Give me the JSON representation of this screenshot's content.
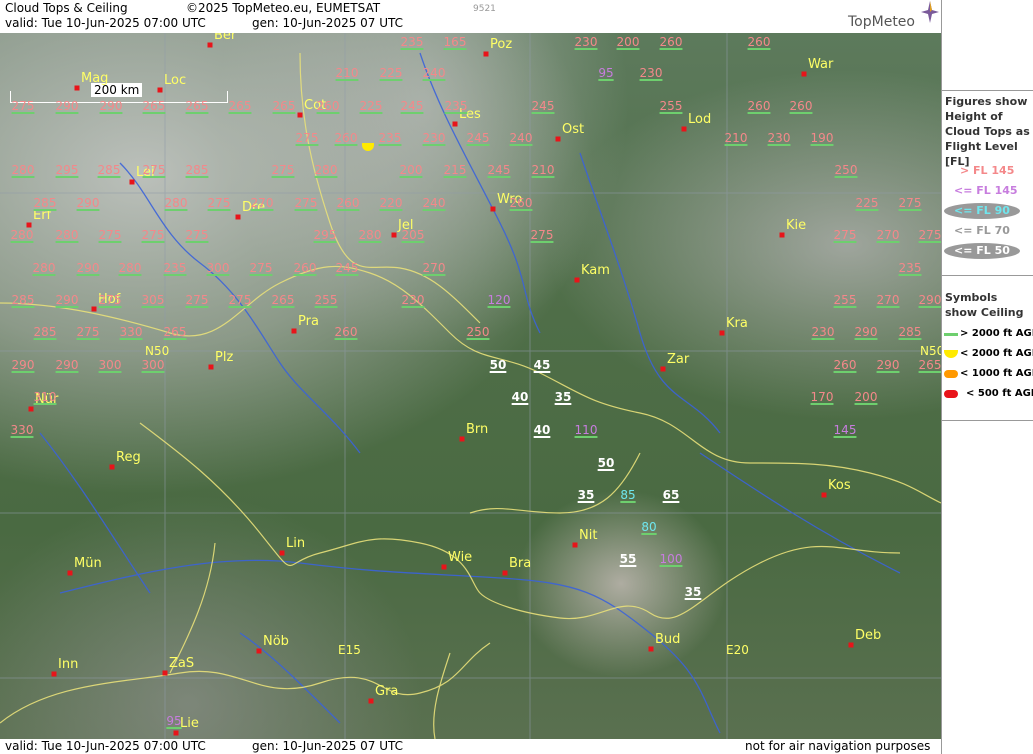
{
  "header": {
    "title": "Cloud Tops & Ceiling",
    "copyright": "©2025 TopMeteo.eu, EUMETSAT",
    "valid": "valid:  Tue  10-Jun-2025  07:00 UTC",
    "gen": "gen: 10-Jun-2025 07 UTC",
    "code": "9521",
    "logo": "TopMeteo"
  },
  "scale_label": "200 km",
  "legend": {
    "fl_title": "Figures show Height of Cloud Tops as Flight Level  [FL]",
    "fl_items": [
      {
        "label": "> FL 145",
        "color": "#f4888a"
      },
      {
        "label": "<= FL 145",
        "color": "#c77dde"
      },
      {
        "label": "<= FL 90",
        "color": "#6fe6ee"
      },
      {
        "label": "<= FL 70",
        "color": "#999999"
      },
      {
        "label": "<= FL 50",
        "color": "#ffffff"
      }
    ],
    "ceiling_title": "Symbols show Ceiling",
    "ceiling_items": [
      {
        "label": "> 2000 ft AGL",
        "color": "#6ecf6e"
      },
      {
        "label": "< 2000 ft AGL",
        "color": "#ffea00"
      },
      {
        "label": "< 1000 ft AGL",
        "color": "#ff9900"
      },
      {
        "label": "< 500 ft AGL",
        "color": "#e8141a"
      }
    ]
  },
  "footer": {
    "valid": "valid:  Tue  10-Jun-2025  07:00 UTC",
    "gen": "gen: 10-Jun-2025 07 UTC",
    "note": "not for air navigation purposes"
  },
  "grid_labels": [
    "N50",
    "N50",
    "E15",
    "E20"
  ],
  "cities": [
    "Ber",
    "Poz",
    "War",
    "Mag",
    "Loc",
    "Cot",
    "Les",
    "Lod",
    "Ost",
    "Lei",
    "Wro",
    "Dre",
    "Erf",
    "Jel",
    "Kie",
    "Kam",
    "Hof",
    "Pra",
    "Kra",
    "Plz",
    "Zar",
    "Nür",
    "Brn",
    "Reg",
    "Kos",
    "Nit",
    "Lin",
    "Mün",
    "Wie",
    "Bra",
    "Bud",
    "Deb",
    "Nöb",
    "Inn",
    "ZaS",
    "Gra",
    "Lie"
  ],
  "cloud_tops": [
    {
      "v": "235",
      "c": "hi"
    },
    {
      "v": "165",
      "c": "hi"
    },
    {
      "v": "230",
      "c": "hi"
    },
    {
      "v": "200",
      "c": "hi"
    },
    {
      "v": "260",
      "c": "hi"
    },
    {
      "v": "260",
      "c": "hi"
    },
    {
      "v": "95",
      "c": "mid"
    },
    {
      "v": "230",
      "c": "hi"
    },
    {
      "v": "210",
      "c": "hi"
    },
    {
      "v": "225",
      "c": "hi"
    },
    {
      "v": "240",
      "c": "hi"
    },
    {
      "v": "275",
      "c": "hi"
    },
    {
      "v": "290",
      "c": "hi"
    },
    {
      "v": "290",
      "c": "hi"
    },
    {
      "v": "265",
      "c": "hi"
    },
    {
      "v": "265",
      "c": "hi"
    },
    {
      "v": "265",
      "c": "hi"
    },
    {
      "v": "265",
      "c": "hi"
    },
    {
      "v": "260",
      "c": "hi"
    },
    {
      "v": "225",
      "c": "hi"
    },
    {
      "v": "245",
      "c": "hi"
    },
    {
      "v": "235",
      "c": "hi"
    },
    {
      "v": "245",
      "c": "hi"
    },
    {
      "v": "255",
      "c": "hi"
    },
    {
      "v": "260",
      "c": "hi"
    },
    {
      "v": "260",
      "c": "hi"
    },
    {
      "v": "275",
      "c": "hi"
    },
    {
      "v": "260",
      "c": "hi"
    },
    {
      "v": "235",
      "c": "hi"
    },
    {
      "v": "230",
      "c": "hi"
    },
    {
      "v": "245",
      "c": "hi"
    },
    {
      "v": "240",
      "c": "hi"
    },
    {
      "v": "210",
      "c": "hi"
    },
    {
      "v": "230",
      "c": "hi"
    },
    {
      "v": "190",
      "c": "hi"
    },
    {
      "v": "280",
      "c": "hi"
    },
    {
      "v": "295",
      "c": "hi"
    },
    {
      "v": "285",
      "c": "hi"
    },
    {
      "v": "275",
      "c": "hi"
    },
    {
      "v": "285",
      "c": "hi"
    },
    {
      "v": "275",
      "c": "hi"
    },
    {
      "v": "280",
      "c": "hi"
    },
    {
      "v": "200",
      "c": "hi"
    },
    {
      "v": "215",
      "c": "hi"
    },
    {
      "v": "245",
      "c": "hi"
    },
    {
      "v": "210",
      "c": "hi"
    },
    {
      "v": "250",
      "c": "hi"
    },
    {
      "v": "285",
      "c": "hi"
    },
    {
      "v": "290",
      "c": "hi"
    },
    {
      "v": "280",
      "c": "hi"
    },
    {
      "v": "275",
      "c": "hi"
    },
    {
      "v": "270",
      "c": "hi"
    },
    {
      "v": "275",
      "c": "hi"
    },
    {
      "v": "260",
      "c": "hi"
    },
    {
      "v": "220",
      "c": "hi"
    },
    {
      "v": "240",
      "c": "hi"
    },
    {
      "v": "260",
      "c": "hi"
    },
    {
      "v": "225",
      "c": "hi"
    },
    {
      "v": "275",
      "c": "hi"
    },
    {
      "v": "280",
      "c": "hi"
    },
    {
      "v": "280",
      "c": "hi"
    },
    {
      "v": "275",
      "c": "hi"
    },
    {
      "v": "275",
      "c": "hi"
    },
    {
      "v": "275",
      "c": "hi"
    },
    {
      "v": "295",
      "c": "hi"
    },
    {
      "v": "280",
      "c": "hi"
    },
    {
      "v": "205",
      "c": "hi"
    },
    {
      "v": "275",
      "c": "hi"
    },
    {
      "v": "275",
      "c": "hi"
    },
    {
      "v": "270",
      "c": "hi"
    },
    {
      "v": "275",
      "c": "hi"
    },
    {
      "v": "280",
      "c": "hi"
    },
    {
      "v": "290",
      "c": "hi"
    },
    {
      "v": "280",
      "c": "hi"
    },
    {
      "v": "235",
      "c": "hi"
    },
    {
      "v": "300",
      "c": "hi"
    },
    {
      "v": "275",
      "c": "hi"
    },
    {
      "v": "260",
      "c": "hi"
    },
    {
      "v": "245",
      "c": "hi"
    },
    {
      "v": "270",
      "c": "hi"
    },
    {
      "v": "235",
      "c": "hi"
    },
    {
      "v": "285",
      "c": "hi"
    },
    {
      "v": "290",
      "c": "hi"
    },
    {
      "v": "275",
      "c": "hi"
    },
    {
      "v": "305",
      "c": "hi"
    },
    {
      "v": "275",
      "c": "hi"
    },
    {
      "v": "275",
      "c": "hi"
    },
    {
      "v": "265",
      "c": "hi"
    },
    {
      "v": "255",
      "c": "hi"
    },
    {
      "v": "230",
      "c": "hi"
    },
    {
      "v": "120",
      "c": "mid"
    },
    {
      "v": "255",
      "c": "hi"
    },
    {
      "v": "270",
      "c": "hi"
    },
    {
      "v": "290",
      "c": "hi"
    },
    {
      "v": "285",
      "c": "hi"
    },
    {
      "v": "275",
      "c": "hi"
    },
    {
      "v": "330",
      "c": "hi"
    },
    {
      "v": "265",
      "c": "hi"
    },
    {
      "v": "260",
      "c": "hi"
    },
    {
      "v": "250",
      "c": "hi"
    },
    {
      "v": "230",
      "c": "hi"
    },
    {
      "v": "290",
      "c": "hi"
    },
    {
      "v": "285",
      "c": "hi"
    },
    {
      "v": "290",
      "c": "hi"
    },
    {
      "v": "290",
      "c": "hi"
    },
    {
      "v": "300",
      "c": "hi"
    },
    {
      "v": "300",
      "c": "hi"
    },
    {
      "v": "50",
      "c": "low"
    },
    {
      "v": "45",
      "c": "low"
    },
    {
      "v": "260",
      "c": "hi"
    },
    {
      "v": "290",
      "c": "hi"
    },
    {
      "v": "265",
      "c": "hi"
    },
    {
      "v": "310",
      "c": "hi"
    },
    {
      "v": "40",
      "c": "low"
    },
    {
      "v": "35",
      "c": "low"
    },
    {
      "v": "170",
      "c": "hi"
    },
    {
      "v": "200",
      "c": "hi"
    },
    {
      "v": "330",
      "c": "hi"
    },
    {
      "v": "40",
      "c": "low"
    },
    {
      "v": "110",
      "c": "mid"
    },
    {
      "v": "145",
      "c": "mid"
    },
    {
      "v": "50",
      "c": "low"
    },
    {
      "v": "35",
      "c": "low"
    },
    {
      "v": "85",
      "c": "cyan"
    },
    {
      "v": "65",
      "c": "low"
    },
    {
      "v": "80",
      "c": "cyan"
    },
    {
      "v": "55",
      "c": "low"
    },
    {
      "v": "100",
      "c": "mid"
    },
    {
      "v": "35",
      "c": "low"
    },
    {
      "v": "95",
      "c": "mid"
    }
  ]
}
